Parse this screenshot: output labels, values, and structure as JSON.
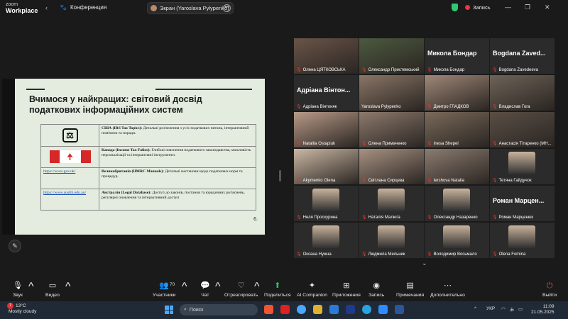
{
  "app": {
    "logo_line1": "zoom",
    "logo_line2": "Workplace",
    "conference_label": "Конференция"
  },
  "share_pill": {
    "text": "Экран (Yaroslava Pylypenko)"
  },
  "recording": {
    "label": "Запись"
  },
  "slide": {
    "title": "Вчимося у найкращих: світовий досвід податкових інформаційних систем",
    "page_number": "6.",
    "rows": [
      {
        "link": "",
        "logo": "irs-logo",
        "bold": "США (IRS Tax Topics):",
        "text": " Детальні роз'яснення з усіх податкових питань, інтерактивний помічник та поради."
      },
      {
        "link": "",
        "logo": "canada-flag",
        "bold": "Канада (Income Tax Folios):",
        "text": " Глибокі пояснення податкового законодавства, можливість персоналізації та інтерактивні інструменти."
      },
      {
        "link": "https://www.gov.uk/",
        "logo": "",
        "bold": "Великобританія (HMRC Manuals):",
        "text": " Детальні настанови щодо податкових норм та процедур."
      },
      {
        "link": "https://www.austlii.edu.au/",
        "logo": "",
        "bold": "Австралія (Legal Database):",
        "text": " Доступ до законів, постанов та юридичних роз'яснень, регулярні оновлення та інтерактивний доступ"
      }
    ]
  },
  "gallery": {
    "tiles": [
      {
        "name": "Олена ЦЯТКОВСЬКА",
        "big": "",
        "muted": true
      },
      {
        "name": "Олександр Пристемський",
        "big": "",
        "muted": true
      },
      {
        "name": "Микола Бондар",
        "big": "Микола Бондар",
        "muted": true
      },
      {
        "name": "Bogdana Zavedeeva",
        "big": "Bogdana Zaved...",
        "muted": true
      },
      {
        "name": "Адріана Вінтоняк",
        "big": "Адріана Вінтон...",
        "muted": true
      },
      {
        "name": "Yaroslava Pylypenko",
        "big": "",
        "muted": false
      },
      {
        "name": "Дмитро ГЛАДКОВ",
        "big": "",
        "muted": true
      },
      {
        "name": "Владислав Гога",
        "big": "",
        "muted": true
      },
      {
        "name": "Natallia Ostapiuk",
        "big": "",
        "muted": true
      },
      {
        "name": "Олена Примаченко",
        "big": "",
        "muted": true
      },
      {
        "name": "Inesa Shepel",
        "big": "",
        "muted": true
      },
      {
        "name": "Анастасія Тітаренко (МН...",
        "big": "",
        "muted": true
      },
      {
        "name": "Akymenko Olena",
        "big": "",
        "muted": true
      },
      {
        "name": "Світлана Сирцева",
        "big": "",
        "muted": true
      },
      {
        "name": "Iershova Natalia",
        "big": "",
        "muted": true
      },
      {
        "name": "Тетяна Гайдучок",
        "big": "",
        "muted": true
      },
      {
        "name": "Неля Проскурина",
        "big": "",
        "muted": true
      },
      {
        "name": "Наталія Малюга",
        "big": "",
        "muted": true
      },
      {
        "name": "Олександр Назаренко",
        "big": "",
        "muted": true
      },
      {
        "name": "Роман Марценюк",
        "big": "Роман Марцен...",
        "muted": true
      },
      {
        "name": "Оксана Нужна",
        "big": "",
        "muted": true
      },
      {
        "name": "Людмила Мельник",
        "big": "",
        "muted": true
      },
      {
        "name": "Володимир Восьмало",
        "big": "",
        "muted": true
      },
      {
        "name": "Olena Fomina",
        "big": "",
        "muted": true
      }
    ]
  },
  "toolbar": {
    "sound": "Звук",
    "video": "Видео",
    "participants": "Участники",
    "participants_count": "70",
    "chat": "Чат",
    "react": "Отреагировать",
    "share": "Поделиться",
    "ai": "AI Companion",
    "apps": "Приложения",
    "record": "Запись",
    "notes": "Примечания",
    "more": "Дополнительно",
    "leave": "Выйти"
  },
  "taskbar": {
    "weather_temp": "13°C",
    "weather_desc": "Mostly cloudy",
    "search_placeholder": "Поиск",
    "language": "УКР",
    "time": "11:09",
    "date": "21.05.2025"
  },
  "colors": {
    "active_speaker": "#22c55e",
    "muted_mic": "#e33333",
    "leave": "#e84a4a",
    "slide_bg": "#e3ecdf"
  }
}
